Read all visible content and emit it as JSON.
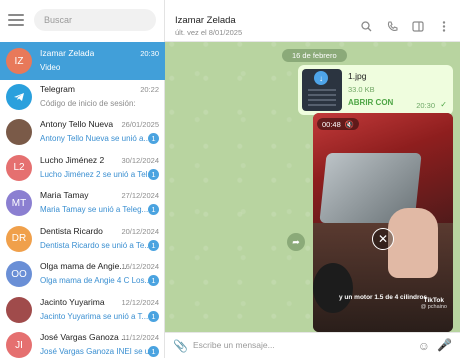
{
  "window": {
    "minimize": "–",
    "maximize": "□",
    "close": "✕"
  },
  "sidebar": {
    "search_placeholder": "Buscar",
    "chats": [
      {
        "name": "Izamar Zelada",
        "time": "20:30",
        "preview": "Video",
        "avatar_text": "IZ",
        "avatar_color": "#e8795a",
        "active": true,
        "pinned": true
      },
      {
        "name": "Telegram",
        "time": "20:22",
        "preview": "Código de inicio de sesión:",
        "avatar_text": "",
        "avatar_color": "#2aa0dd",
        "verified": true
      },
      {
        "name": "Antony Tello Nueva",
        "time": "26/01/2025",
        "preview": "Antony Tello Nueva se unió a...",
        "badge": "1",
        "avatar_color": "#7a5a48"
      },
      {
        "name": "Lucho Jiménez 2",
        "time": "30/12/2024",
        "preview": "Lucho Jiménez 2 se unió a Tel...",
        "badge": "1",
        "avatar_text": "L2",
        "avatar_color": "#e57070"
      },
      {
        "name": "Maria Tamay",
        "time": "27/12/2024",
        "preview": "Maria Tamay se unió a Teleg...",
        "badge": "1",
        "avatar_text": "MT",
        "avatar_color": "#8b7fd1"
      },
      {
        "name": "Dentista Ricardo",
        "time": "20/12/2024",
        "preview": "Dentista Ricardo se unió a Te...",
        "badge": "1",
        "avatar_text": "DR",
        "avatar_color": "#f0a04b"
      },
      {
        "name": "Olga mama de Angie...",
        "time": "16/12/2024",
        "preview": "Olga mama de Angie 4 C Los...",
        "badge": "1",
        "avatar_text": "OO",
        "avatar_color": "#6a8fd6"
      },
      {
        "name": "Jacinto Yuyarima",
        "time": "12/12/2024",
        "preview": "Jacinto Yuyarima se unió a T...",
        "badge": "1",
        "avatar_color": "#a04b4b"
      },
      {
        "name": "José Vargas Ganoza ...",
        "time": "11/12/2024",
        "preview": "José Vargas Ganoza INEI se u...",
        "badge": "1",
        "avatar_text": "JI",
        "avatar_color": "#e57070"
      }
    ]
  },
  "header": {
    "name": "Izamar Zelada",
    "status": "últ. vez el 8/01/2025"
  },
  "messages": {
    "date": "16 de febrero",
    "file": {
      "name": "1.jpg",
      "size": "33.0 KB",
      "action": "ABRIR CON",
      "time": "20:30"
    },
    "video": {
      "duration": "00:48",
      "caption": "y un motor 1.5 de 4 cilindros",
      "watermark": "TikTok",
      "handle": "@ pchaino"
    }
  },
  "composer": {
    "placeholder": "Escribe un mensaje..."
  }
}
